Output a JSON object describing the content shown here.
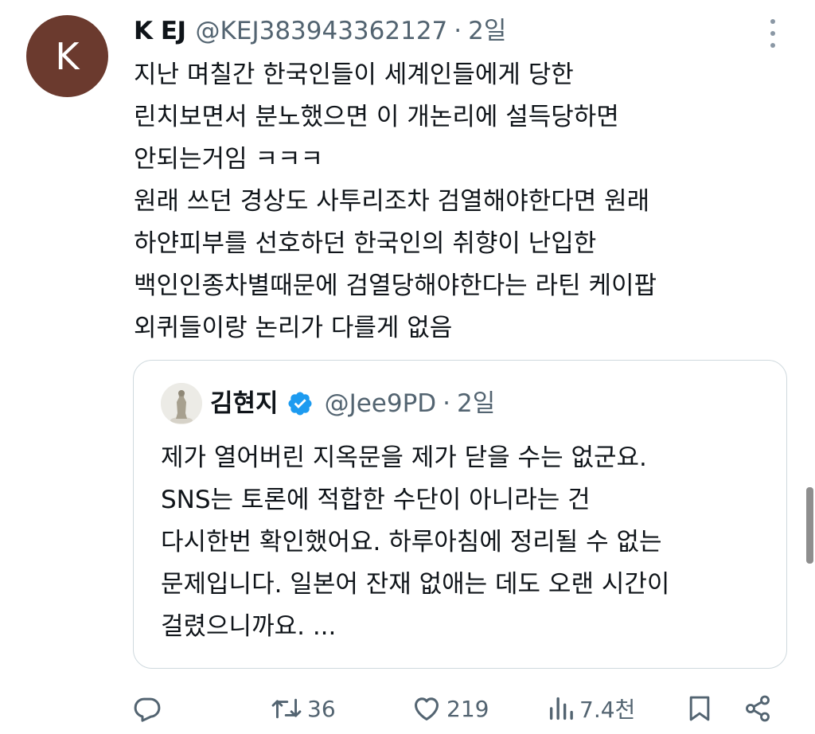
{
  "tweet": {
    "avatar_letter": "K",
    "author_name": "K EJ",
    "handle": "@KEJ383943362127",
    "separator": "·",
    "time": "2일",
    "lines": [
      "지난 며칠간 한국인들이 세계인들에게 당한",
      "린치보면서 분노했으면 이 개논리에 설득당하면",
      "안되는거임 ㅋㅋㅋ",
      "원래 쓰던 경상도 사투리조차 검열해야한다면 원래",
      "하얀피부를 선호하던 한국인의 취향이 난입한",
      "백인인종차별때문에 검열당해야한다는 라틴 케이팝",
      "외퀴들이랑 논리가 다를게 없음"
    ]
  },
  "quoted": {
    "author_name": "김현지",
    "handle": "@Jee9PD",
    "separator": "·",
    "time": "2일",
    "lines": [
      "제가 열어버린 지옥문을 제가 닫을 수는 없군요.",
      "SNS는 토론에 적합한 수단이 아니라는 건",
      "다시한번 확인했어요. 하루아침에 정리될 수 없는",
      "문제입니다. 일본어 잔재 없애는 데도 오랜 시간이",
      "걸렸으니까요. ..."
    ]
  },
  "actions": {
    "reply_count": "",
    "retweet_count": "36",
    "like_count": "219",
    "view_count": "7.4천"
  },
  "icons": {
    "more": "more-vertical-icon",
    "verified": "verified-badge-icon",
    "reply": "reply-icon",
    "retweet": "retweet-icon",
    "like": "heart-icon",
    "views": "views-chart-icon",
    "bookmark": "bookmark-icon",
    "share": "share-icon"
  },
  "colors": {
    "avatar_bg": "#6b3a2e",
    "verified_blue": "#1d9bf0",
    "muted_text": "#536471",
    "border": "#cfd9de"
  }
}
